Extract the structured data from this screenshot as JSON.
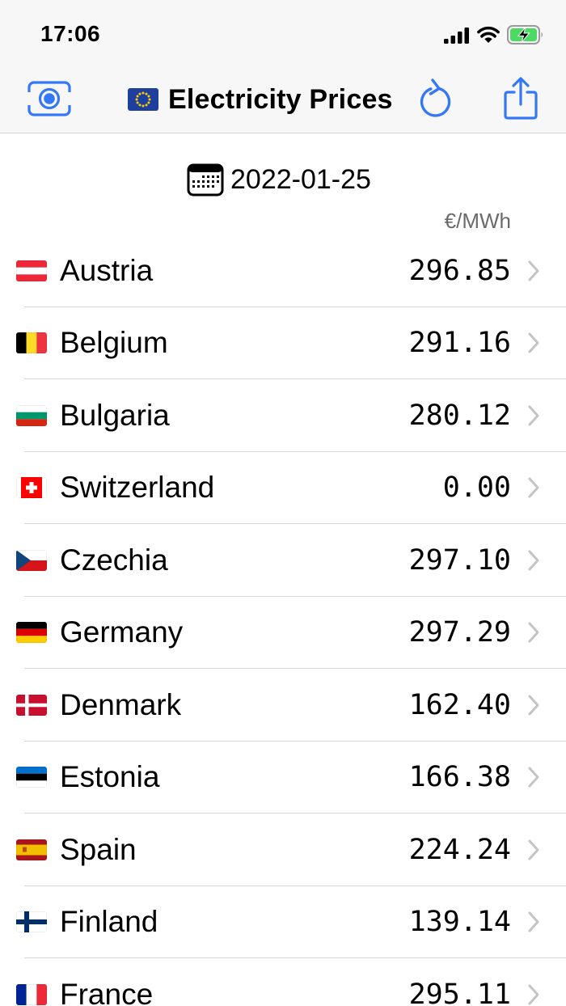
{
  "status_bar": {
    "time": "17:06"
  },
  "nav": {
    "title": "Electricity Prices"
  },
  "date": "2022-01-25",
  "unit": "€/MWh",
  "colors": {
    "accent": "#3478f6",
    "separator": "#d6d6d6",
    "battery_green": "#4cd964"
  },
  "countries": [
    {
      "name": "Austria",
      "price": "296.85",
      "flag": "austria"
    },
    {
      "name": "Belgium",
      "price": "291.16",
      "flag": "belgium"
    },
    {
      "name": "Bulgaria",
      "price": "280.12",
      "flag": "bulgaria"
    },
    {
      "name": "Switzerland",
      "price": "0.00",
      "flag": "switzerland"
    },
    {
      "name": "Czechia",
      "price": "297.10",
      "flag": "czechia"
    },
    {
      "name": "Germany",
      "price": "297.29",
      "flag": "germany"
    },
    {
      "name": "Denmark",
      "price": "162.40",
      "flag": "denmark"
    },
    {
      "name": "Estonia",
      "price": "166.38",
      "flag": "estonia"
    },
    {
      "name": "Spain",
      "price": "224.24",
      "flag": "spain"
    },
    {
      "name": "Finland",
      "price": "139.14",
      "flag": "finland"
    },
    {
      "name": "France",
      "price": "295.11",
      "flag": "france"
    }
  ]
}
